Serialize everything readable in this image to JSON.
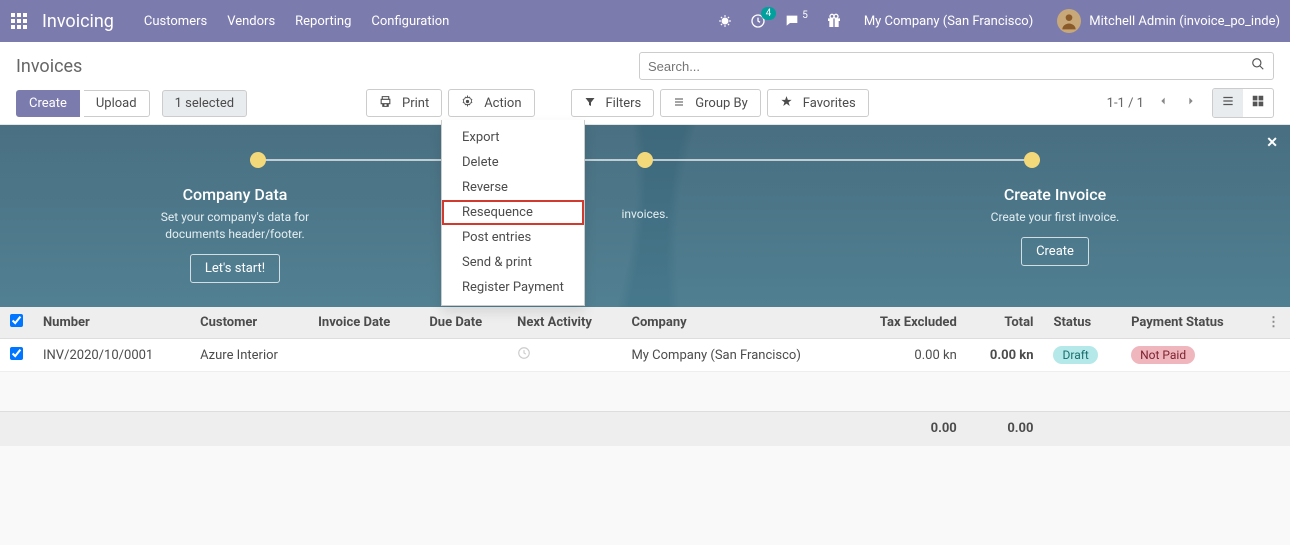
{
  "navbar": {
    "brand": "Invoicing",
    "menus": [
      "Customers",
      "Vendors",
      "Reporting",
      "Configuration"
    ],
    "activity_badge": "4",
    "discuss_badge": "5",
    "company": "My Company (San Francisco)",
    "user": "Mitchell Admin (invoice_po_inde)"
  },
  "breadcrumb": "Invoices",
  "buttons": {
    "create": "Create",
    "upload": "Upload",
    "selected": "1 selected",
    "print": "Print",
    "action": "Action",
    "filters": "Filters",
    "groupby": "Group By",
    "favorites": "Favorites"
  },
  "search_placeholder": "Search...",
  "pager": "1-1 / 1",
  "action_menu": {
    "export": "Export",
    "delete": "Delete",
    "reverse": "Reverse",
    "resequence": "Resequence",
    "post": "Post entries",
    "sendprint": "Send & print",
    "register": "Register Payment"
  },
  "onboard": {
    "step1_title": "Company Data",
    "step1_line1": "Set your company's data for",
    "step1_line2": "documents header/footer.",
    "step1_btn": "Let's start!",
    "step2_line": "invoices.",
    "step3_title": "Create Invoice",
    "step3_line1": "Create your first invoice.",
    "step3_btn": "Create"
  },
  "table": {
    "headers": {
      "number": "Number",
      "customer": "Customer",
      "invoice_date": "Invoice Date",
      "due_date": "Due Date",
      "next_activity": "Next Activity",
      "company": "Company",
      "tax_excluded": "Tax Excluded",
      "total": "Total",
      "status": "Status",
      "payment_status": "Payment Status"
    },
    "rows": [
      {
        "number": "INV/2020/10/0001",
        "customer": "Azure Interior",
        "invoice_date": "",
        "due_date": "",
        "company": "My Company (San Francisco)",
        "tax_excluded": "0.00 kn",
        "total": "0.00 kn",
        "status": "Draft",
        "payment_status": "Not Paid"
      }
    ],
    "footer": {
      "tax_excluded": "0.00",
      "total": "0.00"
    }
  }
}
